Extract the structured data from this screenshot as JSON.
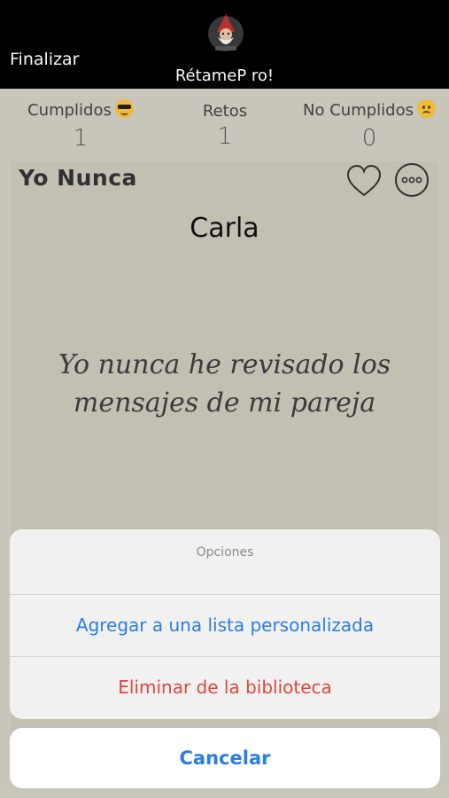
{
  "header": {
    "finish_label": "Finalizar",
    "app_title": "RétameP ro!",
    "logo_icon": "gnome-logo-icon"
  },
  "stats": {
    "done": {
      "label": "Cumplidos",
      "value": "1",
      "emoji": "sunglasses-emoji-icon"
    },
    "challenges": {
      "label": "Retos",
      "value": "1"
    },
    "not_done": {
      "label": "No Cumplidos",
      "value": "0",
      "emoji": "sad-emoji-icon"
    }
  },
  "card": {
    "category": "Yo Nunca",
    "player": "Carla",
    "challenge_text": "Yo nunca he revisado los mensajes de mi pareja",
    "favorite_icon": "heart-icon",
    "more_icon": "more-options-icon"
  },
  "action_sheet": {
    "title": "Opciones",
    "options": [
      {
        "label": "Agregar a una lista personalizada",
        "color": "#2a7de1"
      },
      {
        "label": "Eliminar de la biblioteca",
        "color": "#e2473c"
      }
    ],
    "cancel_label": "Cancelar"
  }
}
